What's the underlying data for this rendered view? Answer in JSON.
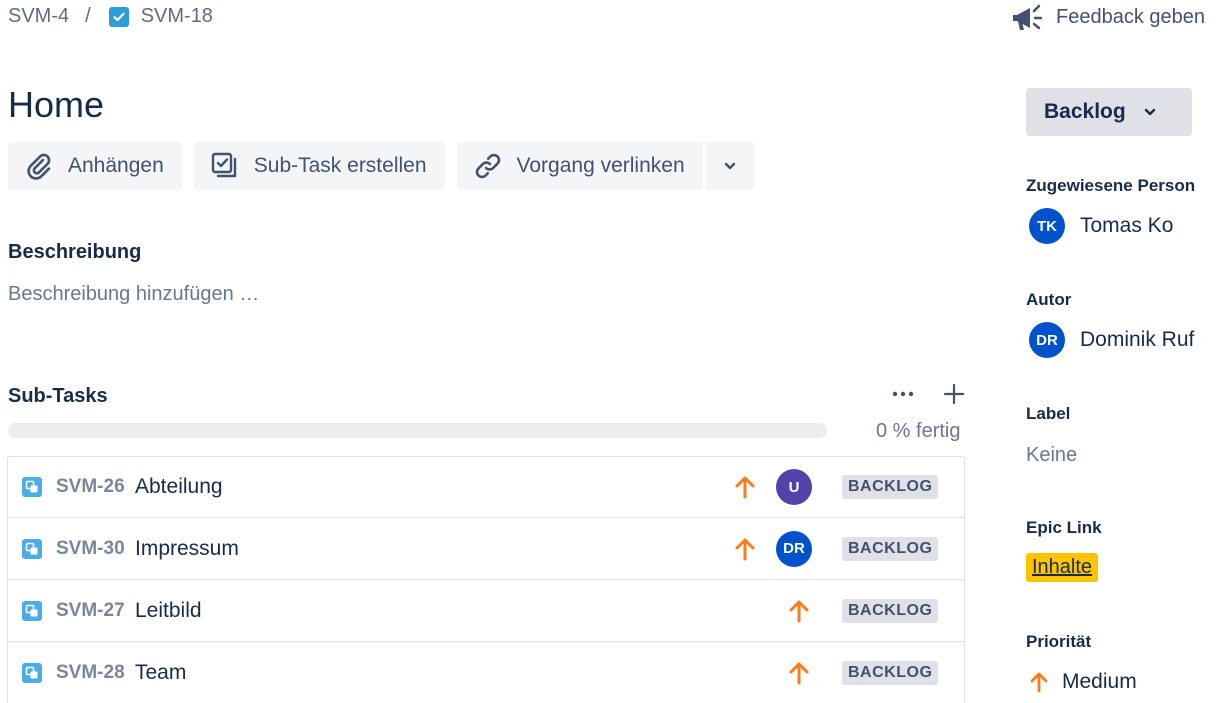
{
  "breadcrumb": {
    "parent": "SVM-4",
    "separator": "/",
    "current": "SVM-18"
  },
  "feedback": {
    "label": "Feedback geben",
    "icon": "megaphone-icon"
  },
  "issue": {
    "title": "Home"
  },
  "actions": {
    "attach": "Anhängen",
    "create_subtask": "Sub-Task erstellen",
    "link_issue": "Vorgang verlinken"
  },
  "description": {
    "heading": "Beschreibung",
    "placeholder": "Beschreibung hinzufügen …"
  },
  "subtasks": {
    "heading": "Sub-Tasks",
    "progress_percent": 0,
    "progress_text": "0 % fertig",
    "items": [
      {
        "key": "SVM-26",
        "summary": "Abteilung",
        "priority": "Medium",
        "assignee_initials": "U",
        "assignee_color": "#5243aa",
        "status": "BACKLOG"
      },
      {
        "key": "SVM-30",
        "summary": "Impressum",
        "priority": "Medium",
        "assignee_initials": "DR",
        "assignee_color": "#0052cc",
        "status": "BACKLOG"
      },
      {
        "key": "SVM-27",
        "summary": "Leitbild",
        "priority": "Medium",
        "assignee_initials": "",
        "assignee_color": "",
        "status": "BACKLOG"
      },
      {
        "key": "SVM-28",
        "summary": "Team",
        "priority": "Medium",
        "assignee_initials": "",
        "assignee_color": "",
        "status": "BACKLOG"
      }
    ]
  },
  "sidebar": {
    "status": "Backlog",
    "assignee": {
      "label": "Zugewiesene Person",
      "initials": "TK",
      "name": "Tomas Ko"
    },
    "reporter": {
      "label": "Autor",
      "initials": "DR",
      "name": "Dominik Ruf"
    },
    "labels": {
      "label": "Label",
      "value": "Keine"
    },
    "epic": {
      "label": "Epic Link",
      "value": "Inhalte",
      "color": "#ffc400"
    },
    "priority": {
      "label": "Priorität",
      "value": "Medium",
      "color": "#ff7a1a"
    }
  }
}
